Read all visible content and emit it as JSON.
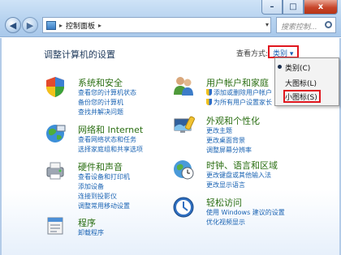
{
  "window": {
    "address_path": "控制面板",
    "search_placeholder": "搜索控制...",
    "controls": {
      "minimize": "–",
      "maximize": "□",
      "close": "x"
    }
  },
  "content": {
    "heading": "调整计算机的设置",
    "view_by_label": "查看方式:",
    "view_by_value": "类别 ▾",
    "view_menu": {
      "items": [
        "类别(C)",
        "大图标(L)",
        "小图标(S)"
      ],
      "selected": "类别(C)",
      "highlighted": "小图标(S)"
    },
    "categories": [
      {
        "title": "系统和安全",
        "icon": "system-security-icon",
        "links": [
          "查看您的计算机状态",
          "备份您的计算机",
          "查找并解决问题"
        ]
      },
      {
        "title": "网络和 Internet",
        "icon": "network-icon",
        "links": [
          "查看网络状态和任务",
          "选择家庭组和共享选项"
        ]
      },
      {
        "title": "硬件和声音",
        "icon": "hardware-sound-icon",
        "links": [
          "查看设备和打印机",
          "添加设备",
          "连接到投影仪",
          "调整常用移动设置"
        ]
      },
      {
        "title": "程序",
        "icon": "programs-icon",
        "links": [
          "卸载程序"
        ]
      },
      {
        "title": "用户帐户和家庭",
        "icon": "user-accounts-icon",
        "links": [
          "添加或删除用户帐户",
          "为所有用户设置家长"
        ]
      },
      {
        "title": "外观和个性化",
        "icon": "appearance-icon",
        "links": [
          "更改主题",
          "更改桌面背景",
          "调整屏幕分辨率"
        ]
      },
      {
        "title": "时钟、语言和区域",
        "icon": "clock-language-icon",
        "links": [
          "更改键盘或其他输入法",
          "更改显示语言"
        ]
      },
      {
        "title": "轻松访问",
        "icon": "ease-of-access-icon",
        "links": [
          "使用 Windows 建议的设置",
          "优化视频显示"
        ]
      }
    ]
  },
  "colors": {
    "category_title": "#2a6e12",
    "link": "#1a63b3",
    "highlight": "#e0161e"
  }
}
